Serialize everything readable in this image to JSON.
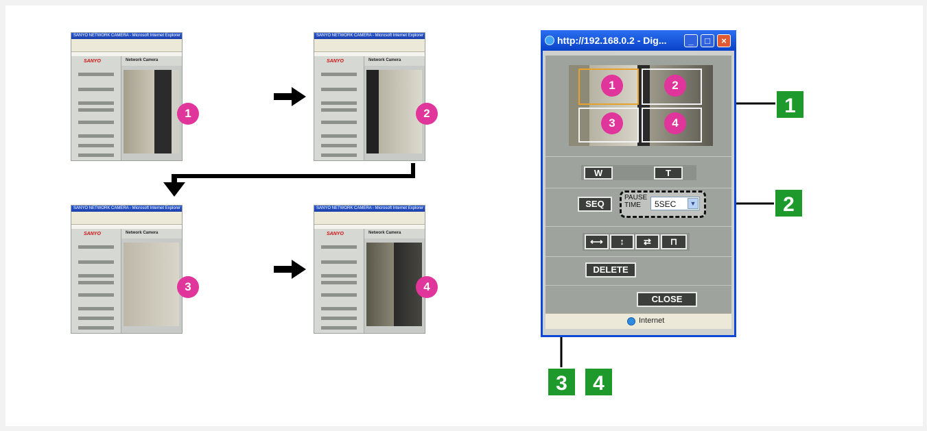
{
  "thumbnails": [
    {
      "title": "SANYO NETWORK CAMERA - Microsoft Internet Explorer",
      "logo": "SANYO",
      "header": "Network Camera",
      "number": "1"
    },
    {
      "title": "SANYO NETWORK CAMERA - Microsoft Internet Explorer",
      "logo": "SANYO",
      "header": "Network Camera",
      "number": "2"
    },
    {
      "title": "SANYO NETWORK CAMERA - Microsoft Internet Explorer",
      "logo": "SANYO",
      "header": "Network Camera",
      "number": "3"
    },
    {
      "title": "SANYO NETWORK CAMERA - Microsoft Internet Explorer",
      "logo": "SANYO",
      "header": "Network Camera",
      "number": "4"
    }
  ],
  "popup": {
    "title": "http://192.168.0.2 - Dig...",
    "quadrants": [
      "1",
      "2",
      "3",
      "4"
    ],
    "zoom": {
      "wide": "W",
      "tele": "T"
    },
    "seq_label": "SEQ",
    "pause_label_1": "PAUSE",
    "pause_label_2": "TIME",
    "pause_value": "5SEC",
    "delete_label": "DELETE",
    "close_label": "CLOSE",
    "status_text": "Internet"
  },
  "callouts": [
    "1",
    "2",
    "3",
    "4"
  ],
  "colors": {
    "callout": "#1e9a2c",
    "badge": "#e0359a",
    "selected_quad": "#e8a22c",
    "titlebar": "#0c47d6"
  }
}
